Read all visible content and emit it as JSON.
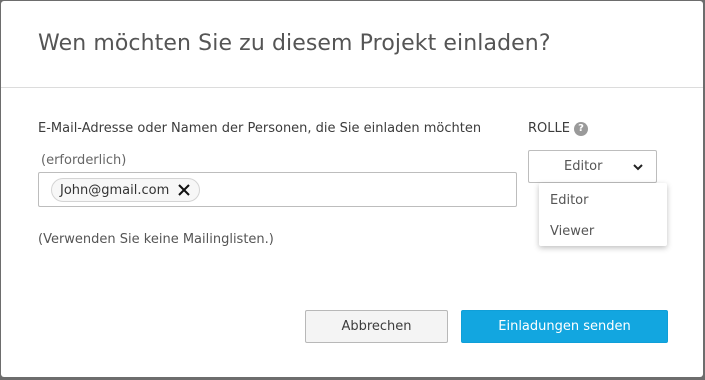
{
  "dialog": {
    "title": "Wen möchten Sie zu diesem Projekt einladen?"
  },
  "email": {
    "label": "E-Mail-Adresse oder Namen der Personen, die Sie einladen möchten",
    "required": "(erforderlich)",
    "chips": [
      "John@gmail.com"
    ],
    "hint": "(Verwenden Sie keine Mailinglisten.)"
  },
  "role": {
    "label": "ROLLE",
    "help_icon": "question-circle-icon",
    "selected": "Editor",
    "options": [
      "Editor",
      "Viewer"
    ]
  },
  "buttons": {
    "cancel": "Abbrechen",
    "send": "Einladungen senden"
  },
  "colors": {
    "primary": "#12a6e0",
    "overlay": "#6d6d6d"
  }
}
